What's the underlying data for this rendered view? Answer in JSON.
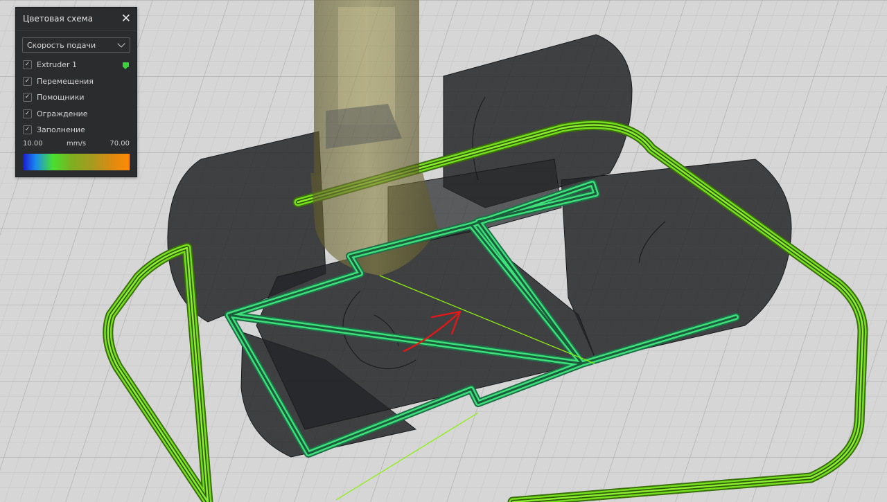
{
  "panel": {
    "title": "Цветовая схема",
    "close_glyph": "✕",
    "scheme_select": {
      "selected": "Скорость подачи"
    },
    "layers": [
      {
        "label": "Extruder 1",
        "checked": true,
        "swatch_color": "#3cd23c"
      },
      {
        "label": "Перемещения",
        "checked": true
      },
      {
        "label": "Помощники",
        "checked": true
      },
      {
        "label": "Ограждение",
        "checked": true
      },
      {
        "label": "Заполнение",
        "checked": true
      }
    ],
    "legend": {
      "min": "10.00",
      "unit": "mm/s",
      "max": "70.00"
    }
  },
  "colors": {
    "panel_bg": "#2b2c2e",
    "skirt_green": "#76e020",
    "wall_green": "#3ee07a",
    "model_gray": "#2a2b2d",
    "nozzle_olive": "#6b6630",
    "arrow_red": "#e01818"
  }
}
